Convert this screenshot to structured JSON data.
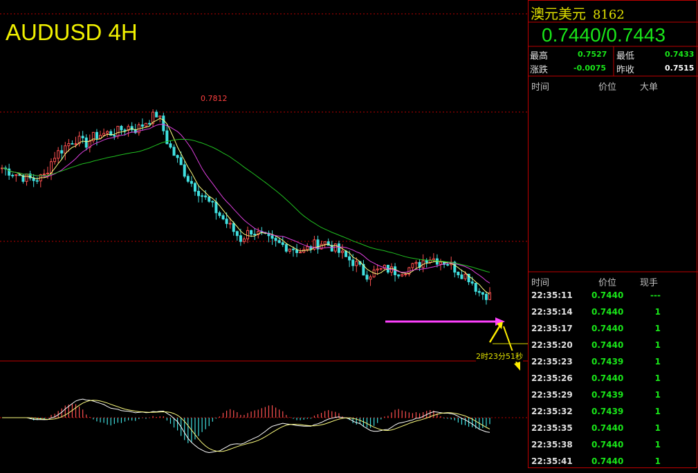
{
  "chart_title": "AUDUSD 4H",
  "high_label": "0.7812",
  "countdown": "2时23分51秒",
  "quote": {
    "name": "澳元美元",
    "code": "8162",
    "bid_ask": "0.7440/0.7443",
    "high_label": "最高",
    "high": "0.7527",
    "low_label": "最低",
    "low": "0.7433",
    "change_label": "涨跌",
    "change": "-0.0075",
    "prev_close_label": "昨收",
    "prev_close": "0.7515"
  },
  "big_orders": {
    "headers": [
      "时间",
      "价位",
      "大单"
    ]
  },
  "ticks": {
    "headers": [
      "时间",
      "价位",
      "现手"
    ],
    "rows": [
      {
        "time": "22:35:11",
        "price": "0.7440",
        "vol": "---"
      },
      {
        "time": "22:35:14",
        "price": "0.7440",
        "vol": "1"
      },
      {
        "time": "22:35:17",
        "price": "0.7440",
        "vol": "1"
      },
      {
        "time": "22:35:20",
        "price": "0.7440",
        "vol": "1"
      },
      {
        "time": "22:35:23",
        "price": "0.7439",
        "vol": "1"
      },
      {
        "time": "22:35:26",
        "price": "0.7440",
        "vol": "1"
      },
      {
        "time": "22:35:29",
        "price": "0.7439",
        "vol": "1"
      },
      {
        "time": "22:35:32",
        "price": "0.7439",
        "vol": "1"
      },
      {
        "time": "22:35:35",
        "price": "0.7440",
        "vol": "1"
      },
      {
        "time": "22:35:38",
        "price": "0.7440",
        "vol": "1"
      },
      {
        "time": "22:35:41",
        "price": "0.7440",
        "vol": "1"
      }
    ]
  },
  "colors": {
    "up": "#ff5050",
    "down": "#40e0e0",
    "ma_short": "#ffff80",
    "ma_mid": "#e040e0",
    "ma_long": "#20c020",
    "grid": "#c00000",
    "support_arrow": "#ff40ff",
    "projection_arrow": "#ffee00"
  },
  "chart_data": {
    "type": "candlestick",
    "title": "AUDUSD 4H",
    "close_path": [
      0.772,
      0.7712,
      0.7705,
      0.77,
      0.7705,
      0.774,
      0.7755,
      0.777,
      0.776,
      0.7775,
      0.7778,
      0.778,
      0.779,
      0.7785,
      0.78,
      0.7812,
      0.776,
      0.773,
      0.77,
      0.768,
      0.766,
      0.764,
      0.762,
      0.76,
      0.7615,
      0.7605,
      0.7595,
      0.759,
      0.7585,
      0.7578,
      0.759,
      0.7595,
      0.7585,
      0.757,
      0.756,
      0.754,
      0.7545,
      0.755,
      0.7545,
      0.755,
      0.7555,
      0.757,
      0.7565,
      0.756,
      0.7545,
      0.7535,
      0.751,
      0.7505
    ],
    "annotations": [
      "0.7812",
      "2时23分51秒"
    ]
  }
}
